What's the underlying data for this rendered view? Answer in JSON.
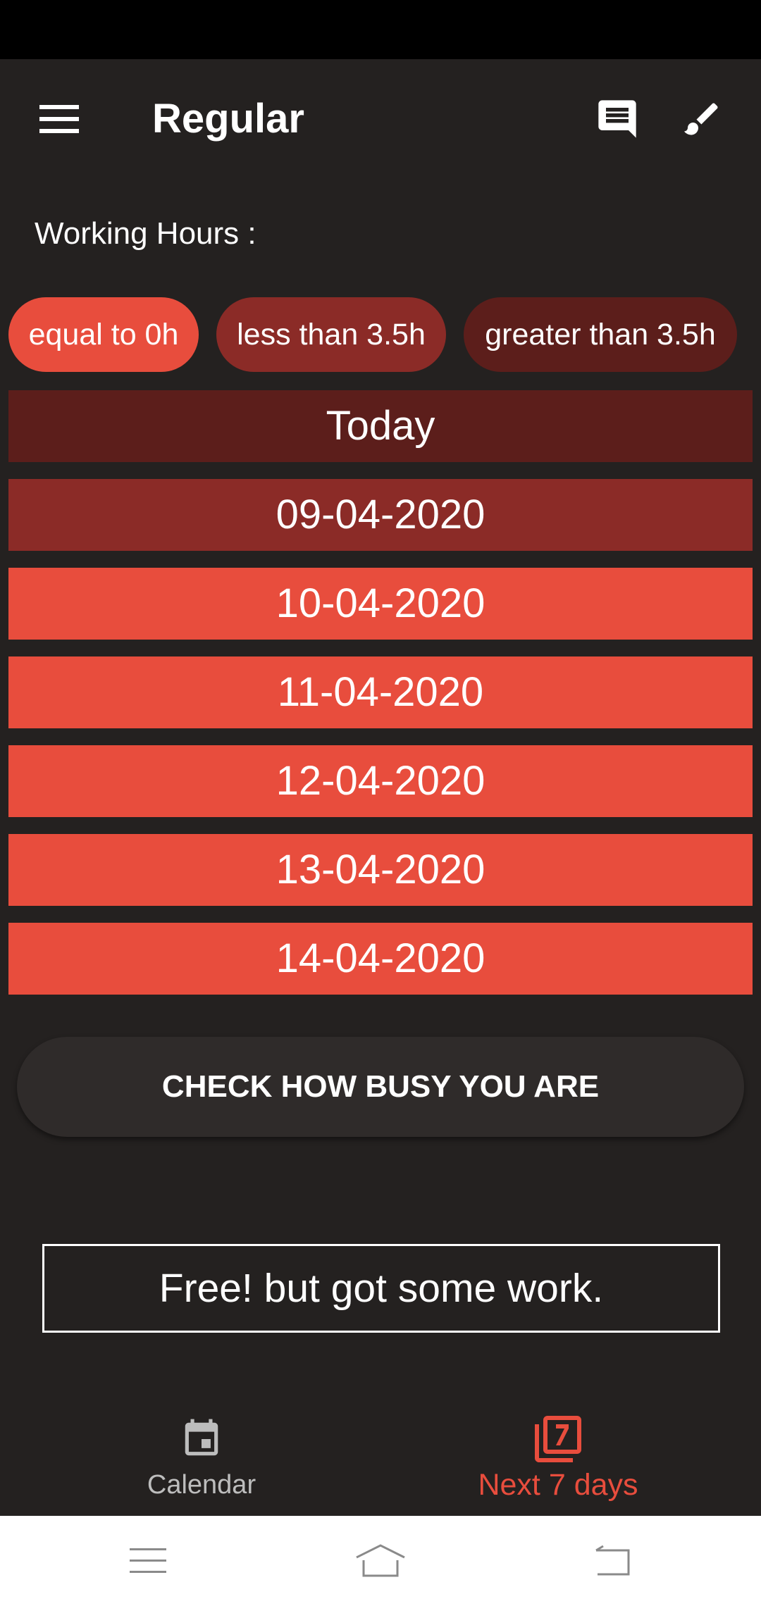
{
  "app_bar": {
    "title": "Regular",
    "icons": [
      "menu-icon",
      "chat-icon",
      "brush-icon"
    ]
  },
  "working_hours": {
    "label": "Working Hours :",
    "legend": [
      {
        "label": "equal to 0h",
        "color": "#e84d3d"
      },
      {
        "label": "less than 3.5h",
        "color": "#8b2b27"
      },
      {
        "label": "greater than 3.5h",
        "color": "#5c1e1b"
      }
    ]
  },
  "days": [
    {
      "label": "Today",
      "color": "#5c1e1b"
    },
    {
      "label": "09-04-2020",
      "color": "#8b2b27"
    },
    {
      "label": "10-04-2020",
      "color": "#e84d3d"
    },
    {
      "label": "11-04-2020",
      "color": "#e84d3d"
    },
    {
      "label": "12-04-2020",
      "color": "#e84d3d"
    },
    {
      "label": "13-04-2020",
      "color": "#e84d3d"
    },
    {
      "label": "14-04-2020",
      "color": "#e84d3d"
    }
  ],
  "check_button": {
    "label": "CHECK HOW BUSY YOU ARE"
  },
  "result": {
    "text": "Free! but got some work."
  },
  "bottom_nav": {
    "items": [
      {
        "label": "Calendar",
        "icon": "calendar-icon",
        "active": false
      },
      {
        "label": "Next 7 days",
        "icon": "filter-7-icon",
        "active": true
      }
    ]
  },
  "colors": {
    "background": "#242120",
    "accent": "#e84d3d",
    "medium": "#8b2b27",
    "dark": "#5c1e1b"
  }
}
